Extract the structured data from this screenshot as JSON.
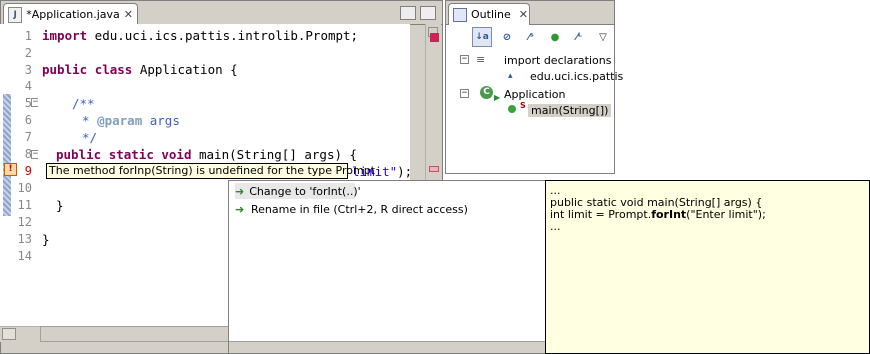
{
  "editor": {
    "tab_title": "*Application.java",
    "tab_icon": "J",
    "close_glyph": "✕",
    "line_numbers": [
      "1",
      "2",
      "3",
      "4",
      "5",
      "6",
      "7",
      "8",
      "9",
      "10",
      "11",
      "12",
      "13",
      "14"
    ],
    "lines": {
      "l1": {
        "kw": "import",
        "rest": " edu.uci.ics.pattis.introlib.Prompt;"
      },
      "l3": {
        "kw1": "public",
        "kw2": "class",
        "rest": " Application {"
      },
      "l5": {
        "text": "/**"
      },
      "l6": {
        "star": "* ",
        "tag": "@param",
        "rest": " args"
      },
      "l7": {
        "text": "*/"
      },
      "l8": {
        "kw1": "public",
        "kw2": "static",
        "kw3": "void",
        "rest": " main(String[] args) {"
      },
      "l9": {
        "str": "limit\"",
        "rest": ");"
      },
      "l11": {
        "text": "}"
      },
      "l13": {
        "text": "}"
      }
    },
    "error_icon": "!"
  },
  "tooltip": {
    "text": "The method forInp(String) is undefined for the type Prompt"
  },
  "outline": {
    "tab_title": "Outline",
    "close_glyph": "✕",
    "toolbar": [
      "az-sort",
      "hide-fields",
      "hide-static",
      "hide-nonpublic",
      "hide-local-types",
      "view-menu"
    ],
    "tree": {
      "imports": "import declarations",
      "import_item": "edu.uci.ics.pattis",
      "class": "Application",
      "method": "main(String[])",
      "static_mark": "S"
    }
  },
  "quickfix": {
    "items": [
      {
        "label": "Change to 'forInt(..)'",
        "icon": "arrow-right-icon"
      },
      {
        "label": "Rename in file (Ctrl+2, R direct access)",
        "icon": "arrow-right-icon"
      }
    ]
  },
  "preview": {
    "l1": "...",
    "l2": "public static void main(String[] args) {",
    "l3_pre": "int limit = Prompt.",
    "l3_bold": "forInt",
    "l3_post": "(\"Enter limit\");",
    "l4": "..."
  },
  "colors": {
    "keyword": "#7f0055",
    "comment": "#3f5fbf",
    "string": "#2a00ff",
    "tooltip_bg": "#ffffe1"
  }
}
